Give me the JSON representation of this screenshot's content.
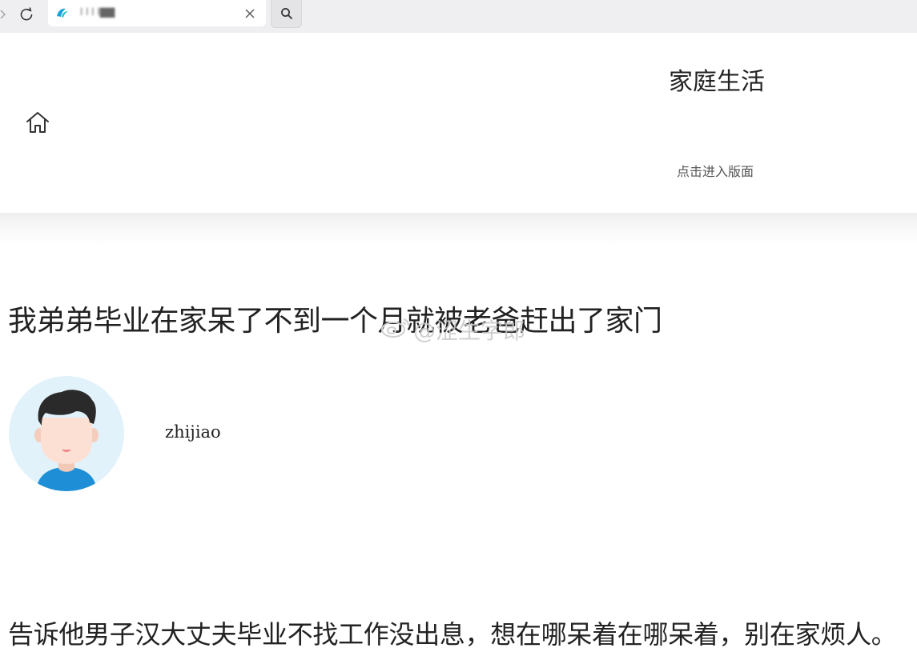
{
  "browser": {
    "tab_title": "l l l l▇▇",
    "tab_close": "✕"
  },
  "header": {
    "category_title": "家庭生活",
    "category_link": "点击进入版面"
  },
  "article": {
    "title": "我弟弟毕业在家呆了不到一个月就被老爸赶出了家门",
    "author": "zhijiao",
    "body": "告诉他男子汉大丈夫毕业不找工作没出息，想在哪呆着在哪呆着，别在家烦人。"
  },
  "watermark": {
    "text": "@涩生字郎"
  },
  "icons": {
    "back": "chevron-right-icon",
    "reload": "reload-icon",
    "favicon": "site-favicon-icon",
    "close": "close-icon",
    "search": "search-icon",
    "home": "home-icon",
    "avatar": "user-avatar-icon"
  },
  "colors": {
    "browser_bar": "#efeff1",
    "favicon_blue": "#1aa3d9",
    "avatar_bg": "#e2f2fb",
    "shirt_blue": "#1e8fd6",
    "text": "#222222"
  }
}
